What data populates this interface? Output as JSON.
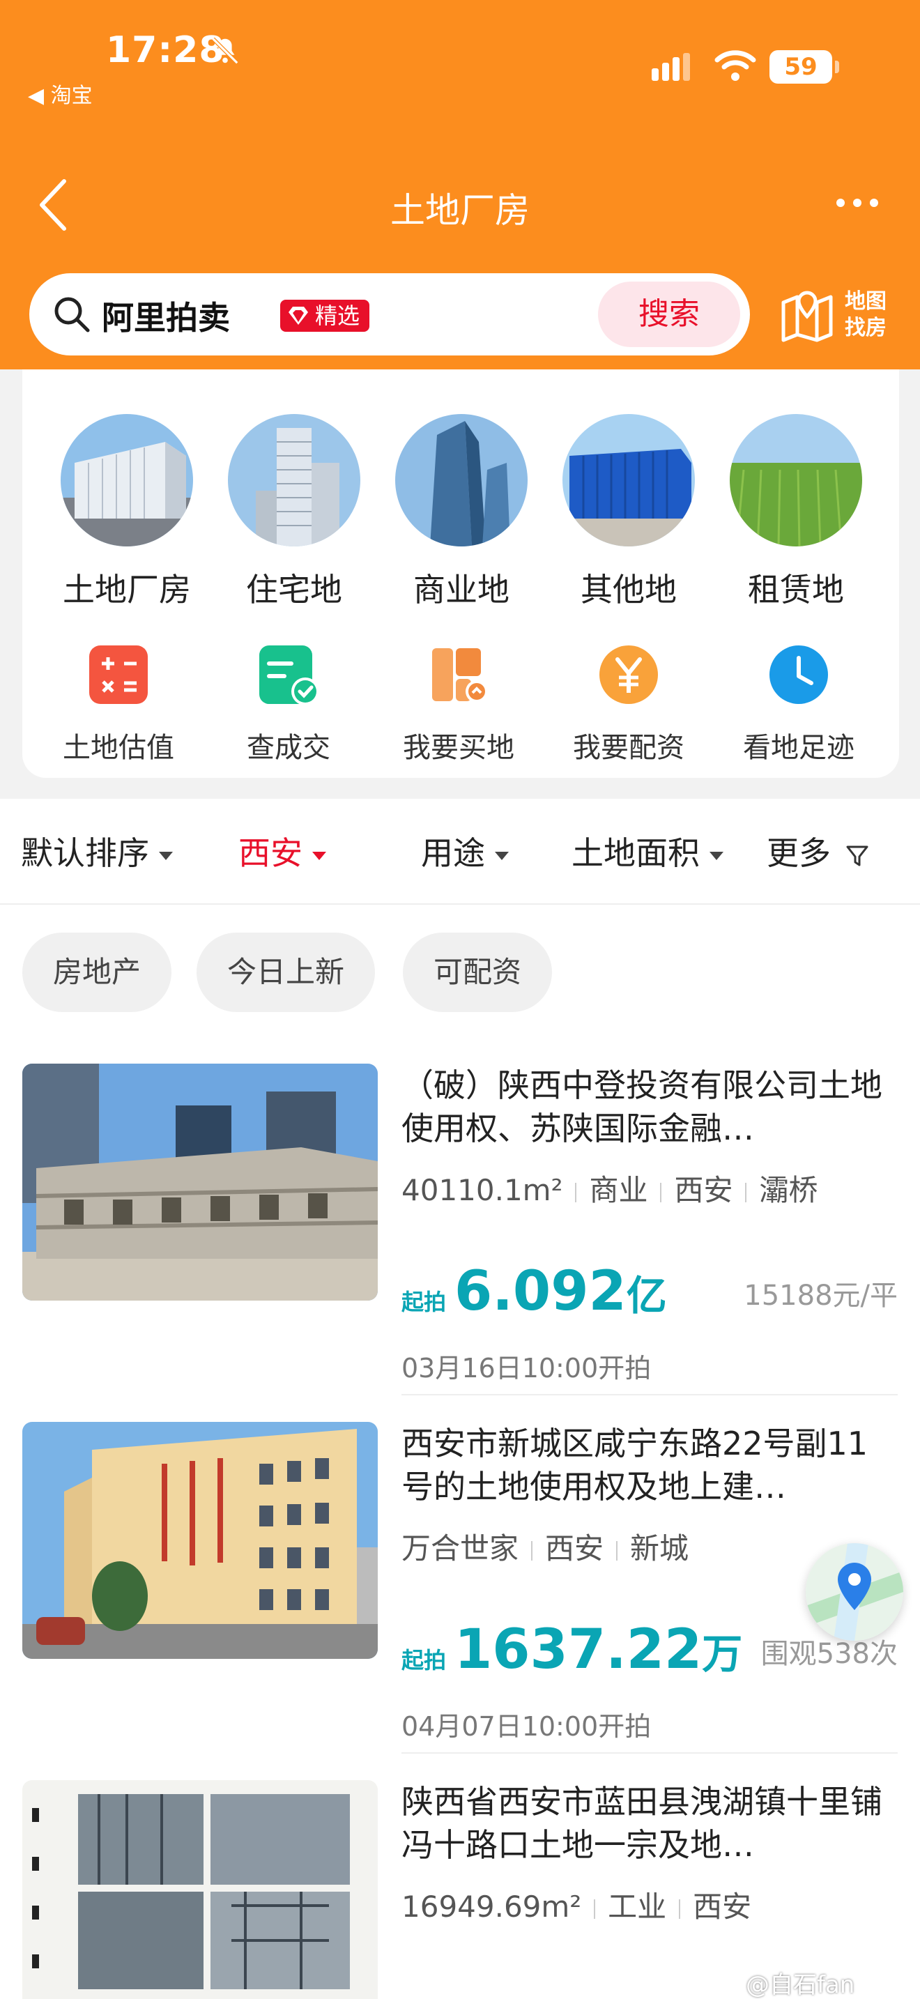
{
  "status": {
    "time": "17:28",
    "back_app": "◀ 淘宝",
    "battery": "59"
  },
  "nav": {
    "title": "土地厂房"
  },
  "search": {
    "value": "阿里拍卖",
    "badge": "精选",
    "button": "搜索",
    "map_label_1": "地图",
    "map_label_2": "找房"
  },
  "categories": [
    {
      "label": "土地厂房",
      "icon": "factory-photo"
    },
    {
      "label": "住宅地",
      "icon": "residential-photo"
    },
    {
      "label": "商业地",
      "icon": "commercial-photo"
    },
    {
      "label": "其他地",
      "icon": "container-photo"
    },
    {
      "label": "租赁地",
      "icon": "farmland-photo"
    }
  ],
  "tools": [
    {
      "label": "土地估值",
      "icon": "calculator-icon"
    },
    {
      "label": "查成交",
      "icon": "deal-check-icon"
    },
    {
      "label": "我要买地",
      "icon": "buy-land-icon"
    },
    {
      "label": "我要配资",
      "icon": "yuan-icon"
    },
    {
      "label": "看地足迹",
      "icon": "clock-icon"
    }
  ],
  "filters": {
    "sort": "默认排序",
    "city": "西安",
    "usage": "用途",
    "area": "土地面积",
    "more": "更多"
  },
  "chips": [
    "房地产",
    "今日上新",
    "可配资"
  ],
  "listings": [
    {
      "title": "（破）陕西中登投资有限公司土地使用权、苏陕国际金融…",
      "tags": [
        "40110.1m²",
        "商业",
        "西安",
        "灞桥"
      ],
      "price_prefix": "起拍",
      "price_value": "6.092",
      "price_unit": "亿",
      "extra": "15188元/平",
      "start": "03月16日10:00开拍"
    },
    {
      "title": "西安市新城区咸宁东路22号副11号的土地使用权及地上建…",
      "tags": [
        "万合世家",
        "西安",
        "新城"
      ],
      "price_prefix": "起拍",
      "price_value": "1637.22",
      "price_unit": "万",
      "extra": "围观538次",
      "start": "04月07日10:00开拍"
    },
    {
      "title": "陕西省西安市蓝田县洩湖镇十里铺冯十路口土地一宗及地…",
      "tags": [
        "16949.69m²",
        "工业",
        "西安"
      ]
    }
  ],
  "watermark": "@自石fan",
  "colors": {
    "header": "#fc8d1e",
    "accent_red": "#e8102a",
    "price_teal": "#0aa5b4"
  }
}
